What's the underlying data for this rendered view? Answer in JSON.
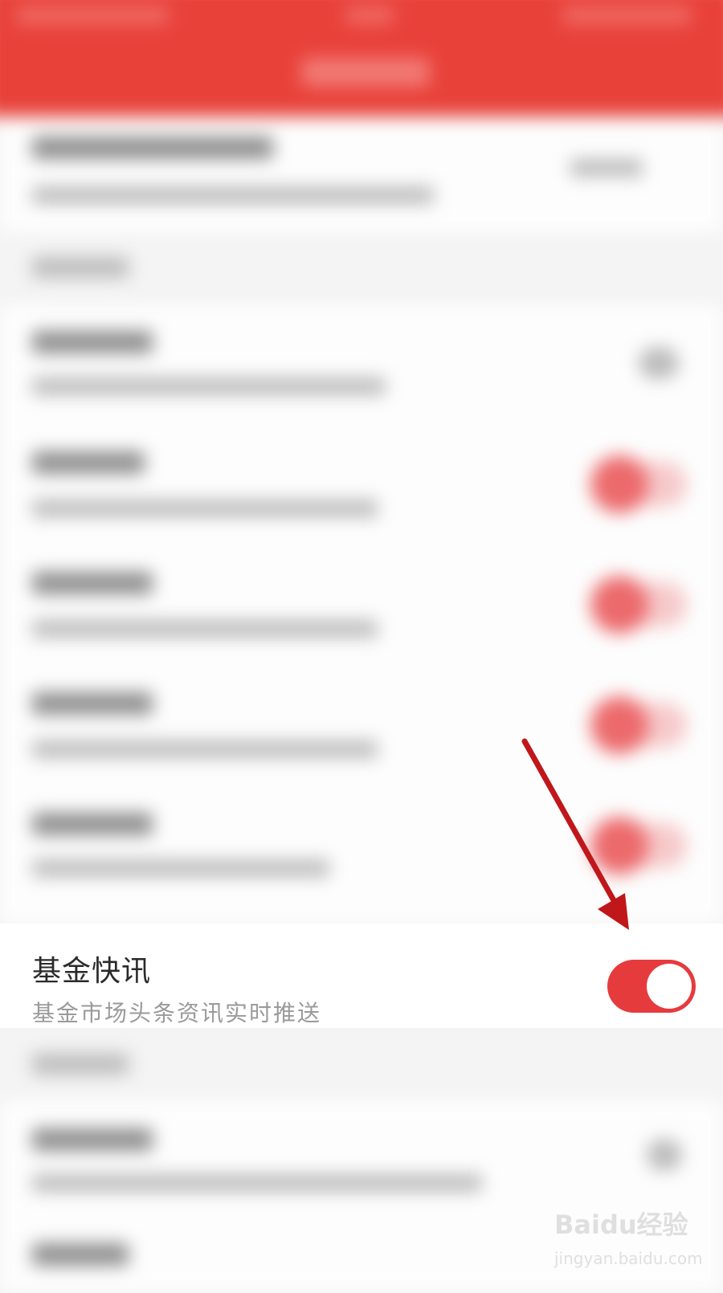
{
  "setting": {
    "title": "基金快讯",
    "subtitle": "基金市场头条资讯实时推送",
    "enabled": true
  },
  "colors": {
    "header": "#e8413a",
    "toggle_on": "#e63b3d",
    "arrow": "#c0171b"
  },
  "watermark": {
    "logo": "Baidu经验",
    "url": "jingyan.baidu.com"
  }
}
